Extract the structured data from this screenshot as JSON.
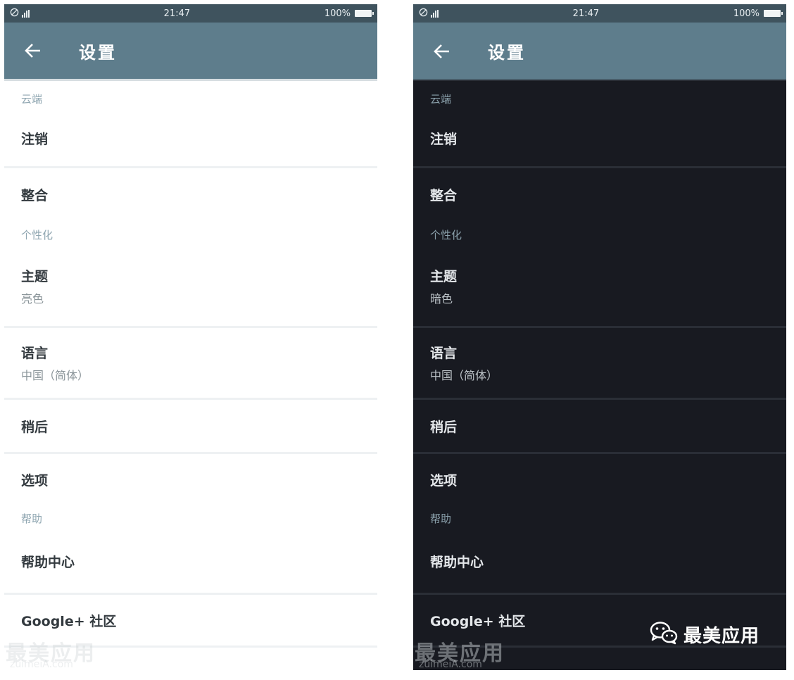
{
  "status_bar": {
    "time": "21:47",
    "battery": "100%"
  },
  "app_bar": {
    "title": "设置"
  },
  "light_screen": {
    "sections": [
      {
        "header": "云端",
        "items": [
          {
            "title": "注销"
          },
          {
            "title": "整合"
          }
        ]
      },
      {
        "header": "个性化",
        "items": [
          {
            "title": "主题",
            "subtitle": "亮色"
          },
          {
            "title": "语言",
            "subtitle": "中国（简体）"
          },
          {
            "title": "稍后"
          },
          {
            "title": "选项"
          }
        ]
      },
      {
        "header": "帮助",
        "items": [
          {
            "title": "帮助中心"
          },
          {
            "title": "Google+ 社区"
          }
        ]
      }
    ]
  },
  "dark_screen": {
    "sections": [
      {
        "header": "云端",
        "items": [
          {
            "title": "注销"
          },
          {
            "title": "整合"
          }
        ]
      },
      {
        "header": "个性化",
        "items": [
          {
            "title": "主题",
            "subtitle": "暗色"
          },
          {
            "title": "语言",
            "subtitle": "中国（简体）"
          },
          {
            "title": "稍后"
          },
          {
            "title": "选项"
          }
        ]
      },
      {
        "header": "帮助",
        "items": [
          {
            "title": "帮助中心"
          },
          {
            "title": "Google+ 社区"
          }
        ]
      }
    ]
  },
  "watermark": {
    "text": "最美应用",
    "url": "zuimeiA.com"
  },
  "wechat_badge": {
    "label": "最美应用"
  },
  "colors": {
    "app_bar": "#5e7d8c",
    "status_bar": "#3f535e",
    "dark_bg": "#181a21",
    "section_header": "#8fa6b1"
  },
  "icons": {
    "back": "arrow-left-icon",
    "wechat": "wechat-icon",
    "battery": "battery-icon",
    "signal": "signal-icon"
  }
}
